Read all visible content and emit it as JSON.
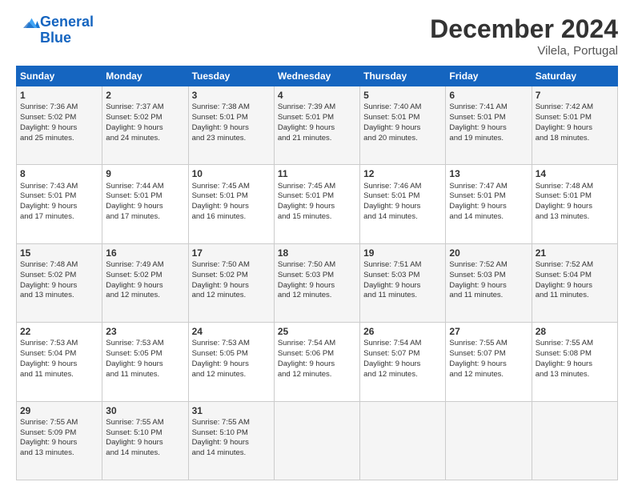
{
  "header": {
    "logo_line1": "General",
    "logo_line2": "Blue",
    "month": "December 2024",
    "location": "Vilela, Portugal"
  },
  "weekdays": [
    "Sunday",
    "Monday",
    "Tuesday",
    "Wednesday",
    "Thursday",
    "Friday",
    "Saturday"
  ],
  "weeks": [
    [
      {
        "day": "1",
        "lines": [
          "Sunrise: 7:36 AM",
          "Sunset: 5:02 PM",
          "Daylight: 9 hours",
          "and 25 minutes."
        ]
      },
      {
        "day": "2",
        "lines": [
          "Sunrise: 7:37 AM",
          "Sunset: 5:02 PM",
          "Daylight: 9 hours",
          "and 24 minutes."
        ]
      },
      {
        "day": "3",
        "lines": [
          "Sunrise: 7:38 AM",
          "Sunset: 5:01 PM",
          "Daylight: 9 hours",
          "and 23 minutes."
        ]
      },
      {
        "day": "4",
        "lines": [
          "Sunrise: 7:39 AM",
          "Sunset: 5:01 PM",
          "Daylight: 9 hours",
          "and 21 minutes."
        ]
      },
      {
        "day": "5",
        "lines": [
          "Sunrise: 7:40 AM",
          "Sunset: 5:01 PM",
          "Daylight: 9 hours",
          "and 20 minutes."
        ]
      },
      {
        "day": "6",
        "lines": [
          "Sunrise: 7:41 AM",
          "Sunset: 5:01 PM",
          "Daylight: 9 hours",
          "and 19 minutes."
        ]
      },
      {
        "day": "7",
        "lines": [
          "Sunrise: 7:42 AM",
          "Sunset: 5:01 PM",
          "Daylight: 9 hours",
          "and 18 minutes."
        ]
      }
    ],
    [
      {
        "day": "8",
        "lines": [
          "Sunrise: 7:43 AM",
          "Sunset: 5:01 PM",
          "Daylight: 9 hours",
          "and 17 minutes."
        ]
      },
      {
        "day": "9",
        "lines": [
          "Sunrise: 7:44 AM",
          "Sunset: 5:01 PM",
          "Daylight: 9 hours",
          "and 17 minutes."
        ]
      },
      {
        "day": "10",
        "lines": [
          "Sunrise: 7:45 AM",
          "Sunset: 5:01 PM",
          "Daylight: 9 hours",
          "and 16 minutes."
        ]
      },
      {
        "day": "11",
        "lines": [
          "Sunrise: 7:45 AM",
          "Sunset: 5:01 PM",
          "Daylight: 9 hours",
          "and 15 minutes."
        ]
      },
      {
        "day": "12",
        "lines": [
          "Sunrise: 7:46 AM",
          "Sunset: 5:01 PM",
          "Daylight: 9 hours",
          "and 14 minutes."
        ]
      },
      {
        "day": "13",
        "lines": [
          "Sunrise: 7:47 AM",
          "Sunset: 5:01 PM",
          "Daylight: 9 hours",
          "and 14 minutes."
        ]
      },
      {
        "day": "14",
        "lines": [
          "Sunrise: 7:48 AM",
          "Sunset: 5:01 PM",
          "Daylight: 9 hours",
          "and 13 minutes."
        ]
      }
    ],
    [
      {
        "day": "15",
        "lines": [
          "Sunrise: 7:48 AM",
          "Sunset: 5:02 PM",
          "Daylight: 9 hours",
          "and 13 minutes."
        ]
      },
      {
        "day": "16",
        "lines": [
          "Sunrise: 7:49 AM",
          "Sunset: 5:02 PM",
          "Daylight: 9 hours",
          "and 12 minutes."
        ]
      },
      {
        "day": "17",
        "lines": [
          "Sunrise: 7:50 AM",
          "Sunset: 5:02 PM",
          "Daylight: 9 hours",
          "and 12 minutes."
        ]
      },
      {
        "day": "18",
        "lines": [
          "Sunrise: 7:50 AM",
          "Sunset: 5:03 PM",
          "Daylight: 9 hours",
          "and 12 minutes."
        ]
      },
      {
        "day": "19",
        "lines": [
          "Sunrise: 7:51 AM",
          "Sunset: 5:03 PM",
          "Daylight: 9 hours",
          "and 11 minutes."
        ]
      },
      {
        "day": "20",
        "lines": [
          "Sunrise: 7:52 AM",
          "Sunset: 5:03 PM",
          "Daylight: 9 hours",
          "and 11 minutes."
        ]
      },
      {
        "day": "21",
        "lines": [
          "Sunrise: 7:52 AM",
          "Sunset: 5:04 PM",
          "Daylight: 9 hours",
          "and 11 minutes."
        ]
      }
    ],
    [
      {
        "day": "22",
        "lines": [
          "Sunrise: 7:53 AM",
          "Sunset: 5:04 PM",
          "Daylight: 9 hours",
          "and 11 minutes."
        ]
      },
      {
        "day": "23",
        "lines": [
          "Sunrise: 7:53 AM",
          "Sunset: 5:05 PM",
          "Daylight: 9 hours",
          "and 11 minutes."
        ]
      },
      {
        "day": "24",
        "lines": [
          "Sunrise: 7:53 AM",
          "Sunset: 5:05 PM",
          "Daylight: 9 hours",
          "and 12 minutes."
        ]
      },
      {
        "day": "25",
        "lines": [
          "Sunrise: 7:54 AM",
          "Sunset: 5:06 PM",
          "Daylight: 9 hours",
          "and 12 minutes."
        ]
      },
      {
        "day": "26",
        "lines": [
          "Sunrise: 7:54 AM",
          "Sunset: 5:07 PM",
          "Daylight: 9 hours",
          "and 12 minutes."
        ]
      },
      {
        "day": "27",
        "lines": [
          "Sunrise: 7:55 AM",
          "Sunset: 5:07 PM",
          "Daylight: 9 hours",
          "and 12 minutes."
        ]
      },
      {
        "day": "28",
        "lines": [
          "Sunrise: 7:55 AM",
          "Sunset: 5:08 PM",
          "Daylight: 9 hours",
          "and 13 minutes."
        ]
      }
    ],
    [
      {
        "day": "29",
        "lines": [
          "Sunrise: 7:55 AM",
          "Sunset: 5:09 PM",
          "Daylight: 9 hours",
          "and 13 minutes."
        ]
      },
      {
        "day": "30",
        "lines": [
          "Sunrise: 7:55 AM",
          "Sunset: 5:10 PM",
          "Daylight: 9 hours",
          "and 14 minutes."
        ]
      },
      {
        "day": "31",
        "lines": [
          "Sunrise: 7:55 AM",
          "Sunset: 5:10 PM",
          "Daylight: 9 hours",
          "and 14 minutes."
        ]
      },
      null,
      null,
      null,
      null
    ]
  ]
}
